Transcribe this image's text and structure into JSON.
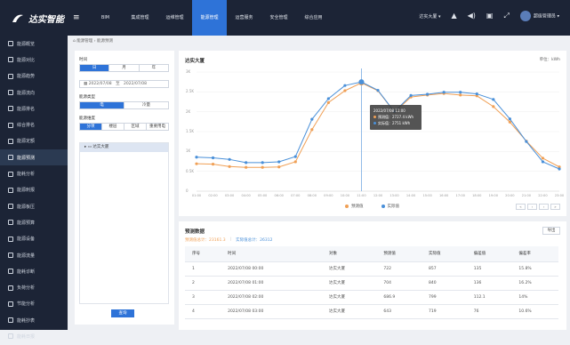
{
  "app": {
    "logo_text": "达实智能"
  },
  "topnav": {
    "items": [
      "BIM",
      "集成管理",
      "运维管理",
      "能源管理",
      "运营服务",
      "安全管理",
      "综合应用"
    ],
    "active_index": 3
  },
  "topright": {
    "building": "达实大厦 ▾",
    "user": "超级管理员 ▾"
  },
  "sidebar": {
    "items": [
      "能源概览",
      "能源对比",
      "能源趋势",
      "能源流向",
      "能源排名",
      "综合排名",
      "能源定额",
      "能源预测",
      "能耗分析",
      "能源刺报",
      "能源板压",
      "能源预算",
      "能源设备",
      "能源流量",
      "能耗诊断",
      "负荷分析",
      "节能分析",
      "能耗抄表",
      "能耗日报"
    ],
    "active_index": 7
  },
  "breadcrumb": "能源管理 › 能源预测",
  "filter": {
    "time_label": "时间",
    "time_options": [
      "日",
      "月",
      "年"
    ],
    "date_start": "2022/07/08",
    "date_sep": "至",
    "date_end": "2022/07/08",
    "energy_type_label": "能源类型",
    "energy_types": [
      "电",
      "冷量"
    ],
    "dimension_label": "能源维度",
    "dimensions": [
      "分项",
      "楼层",
      "区域",
      "重要用电"
    ],
    "tree_node": "▸  ▭  达实大厦",
    "query_label": "查询"
  },
  "chart": {
    "title": "达实大厦",
    "unit": "单位：kWh",
    "tooltip_time": "2022/07/08 11:00",
    "tooltip_pred": "预测值：2727.4 kWh",
    "tooltip_act": "实际值：2751 kWh",
    "pager": [
      "«",
      "‹",
      "›",
      "»"
    ]
  },
  "chart_data": {
    "type": "line",
    "x": [
      "01:00",
      "02:00",
      "03:00",
      "04:00",
      "05:00",
      "06:00",
      "07:00",
      "08:00",
      "09:00",
      "10:00",
      "11:00",
      "12:00",
      "13:00",
      "14:00",
      "15:00",
      "16:00",
      "17:00",
      "18:00",
      "19:00",
      "20:00",
      "21:00",
      "22:00",
      "23:00"
    ],
    "series": [
      {
        "name": "预测值",
        "color": "#f0a056",
        "values": [
          690,
          680,
          620,
          600,
          600,
          610,
          740,
          1550,
          2230,
          2530,
          2727.4,
          2530,
          1990,
          2370,
          2420,
          2460,
          2420,
          2400,
          2130,
          1740,
          1260,
          830,
          610
        ]
      },
      {
        "name": "实际值",
        "color": "#4a90d9",
        "values": [
          857,
          840,
          799,
          719,
          719,
          739,
          871,
          1810,
          2330,
          2660,
          2751,
          2540,
          2000,
          2410,
          2440,
          2490,
          2490,
          2450,
          2310,
          1820,
          1250,
          740,
          560
        ]
      }
    ],
    "yticks": [
      "0",
      "0.5K",
      "1K",
      "1.5K",
      "2K",
      "2.5K",
      "3K"
    ],
    "ylim": [
      0,
      3000
    ]
  },
  "table": {
    "title": "预测数据",
    "export_label": "导出",
    "pred_total": "预测值总计：23161.3",
    "act_total": "实际值总计：26312",
    "headers": [
      "序号",
      "时间",
      "对象",
      "预测值",
      "实际值",
      "偏差值",
      "偏差率"
    ],
    "rows": [
      [
        "1",
        "2022/07/08 00:00",
        "达实大厦",
        "722",
        "857",
        "135",
        "15.8%"
      ],
      [
        "2",
        "2022/07/08 01:00",
        "达实大厦",
        "704",
        "840",
        "136",
        "16.2%"
      ],
      [
        "3",
        "2022/07/08 02:00",
        "达实大厦",
        "686.9",
        "799",
        "112.1",
        "14%"
      ],
      [
        "4",
        "2022/07/08 03:00",
        "达实大厦",
        "643",
        "719",
        "76",
        "10.6%"
      ]
    ]
  }
}
